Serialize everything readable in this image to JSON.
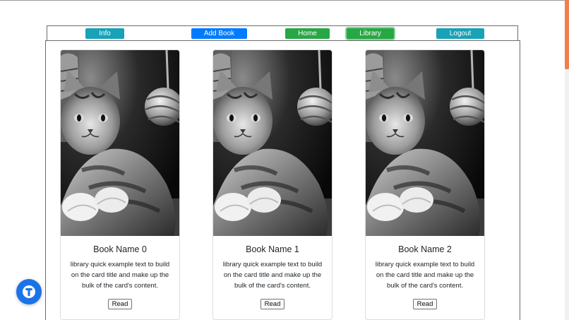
{
  "nav": {
    "info_label": "Info",
    "add_book_label": "Add Book",
    "home_label": "Home",
    "library_label": "Library",
    "logout_label": "Logout",
    "active": "Library"
  },
  "books": [
    {
      "title": "Book Name 0",
      "text": "library quick example text to build on the card title and make up the bulk of the card's content.",
      "button": "Read",
      "image": "grayscale kitten photo"
    },
    {
      "title": "Book Name 1",
      "text": "library quick example text to build on the card title and make up the bulk of the card's content.",
      "button": "Read",
      "image": "grayscale kitten photo"
    },
    {
      "title": "Book Name 2",
      "text": "library quick example text to build on the card title and make up the bulk of the card's content.",
      "button": "Read",
      "image": "grayscale kitten photo"
    }
  ],
  "colors": {
    "info": "#17a2b8",
    "primary": "#007bff",
    "success": "#28a745",
    "scrollbar_thumb": "#f07f4e",
    "fab": "#1a73e8"
  },
  "icons": {
    "fab": "assistant-logo-icon"
  }
}
